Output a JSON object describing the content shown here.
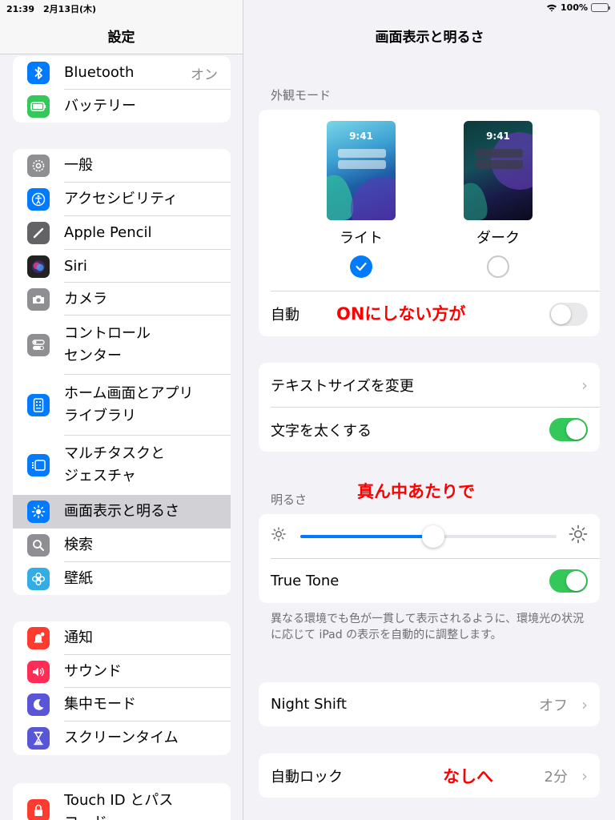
{
  "status_bar": {
    "time": "21:39　2月13日(木)",
    "battery": "100%",
    "battery_level": 1.0
  },
  "sidebar": {
    "title": "設定",
    "group1": [
      {
        "label": "Bluetooth",
        "value": "オン",
        "icon": "bluetooth-icon",
        "color": "#007aff"
      },
      {
        "label": "バッテリー",
        "icon": "battery-icon",
        "color": "#34c759"
      }
    ],
    "group2": [
      {
        "label": "一般",
        "icon": "gear-icon",
        "color": "#8e8e93"
      },
      {
        "label": "アクセシビリティ",
        "icon": "accessibility-icon",
        "color": "#007aff"
      },
      {
        "label": "Apple Pencil",
        "icon": "pencil-icon",
        "color": "#636366"
      },
      {
        "label": "Siri",
        "icon": "siri-icon",
        "color": "#222222"
      },
      {
        "label": "カメラ",
        "icon": "camera-icon",
        "color": "#8e8e93"
      },
      {
        "label": "コントロール\nセンター",
        "icon": "control-center-icon",
        "color": "#8e8e93"
      },
      {
        "label": "ホーム画面とアプリ\nライブラリ",
        "icon": "home-screen-icon",
        "color": "#007aff"
      },
      {
        "label": "マルチタスクと\nジェスチャ",
        "icon": "multitasking-icon",
        "color": "#007aff"
      },
      {
        "label": "画面表示と明るさ",
        "icon": "brightness-icon",
        "color": "#007aff",
        "selected": true
      },
      {
        "label": "検索",
        "icon": "search-icon",
        "color": "#8e8e93"
      },
      {
        "label": "壁紙",
        "icon": "wallpaper-icon",
        "color": "#32ade6"
      }
    ],
    "group3": [
      {
        "label": "通知",
        "icon": "notification-icon",
        "color": "#ff3b30"
      },
      {
        "label": "サウンド",
        "icon": "sound-icon",
        "color": "#ff2d55"
      },
      {
        "label": "集中モード",
        "icon": "moon-icon",
        "color": "#5856d6"
      },
      {
        "label": "スクリーンタイム",
        "icon": "hourglass-icon",
        "color": "#5856d6"
      }
    ],
    "group4": [
      {
        "label": "Touch ID とパス\nコード",
        "icon": "fingerprint-icon",
        "color": "#ff3b30"
      }
    ]
  },
  "main": {
    "title": "画面表示と明るさ",
    "appearance": {
      "section_label": "外観モード",
      "preview_time": "9:41",
      "light_label": "ライト",
      "dark_label": "ダーク",
      "selected": "light",
      "auto_label": "自動",
      "auto_on": false,
      "annotation": "ONにしない方が"
    },
    "text": {
      "text_size_label": "テキストサイズを変更",
      "bold_label": "文字を太くする",
      "bold_on": true
    },
    "brightness": {
      "section_label": "明るさ",
      "annotation": "真ん中あたりで",
      "level": 0.52,
      "true_tone_label": "True Tone",
      "true_tone_on": true,
      "footnote": "異なる環境でも色が一貫して表示されるように、環境光の状況に応じて iPad の表示を自動的に調整します。"
    },
    "night_shift": {
      "label": "Night Shift",
      "value": "オフ"
    },
    "auto_lock": {
      "label": "自動ロック",
      "value": "2分",
      "annotation": "なしへ"
    }
  },
  "colors": {
    "accent": "#007aff",
    "toggle_on": "#34c759",
    "annotation": "#ff0000"
  }
}
